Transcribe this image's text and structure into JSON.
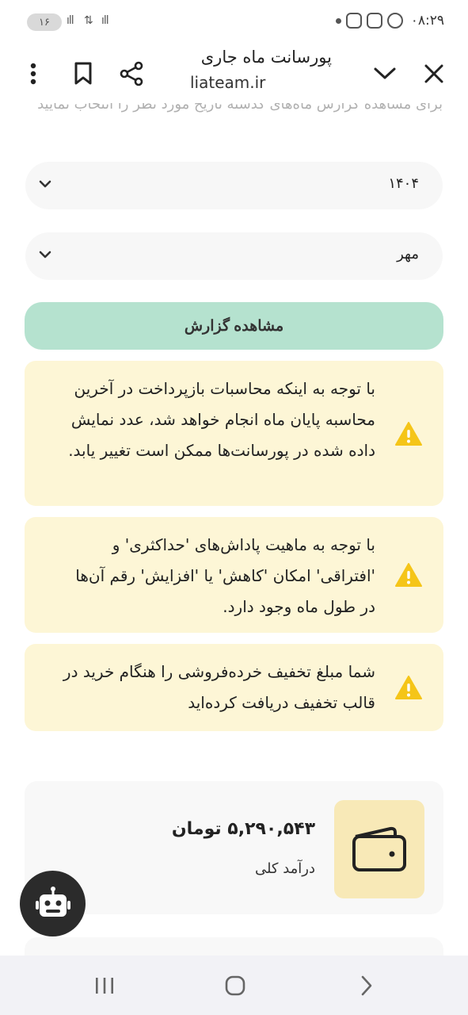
{
  "status_bar": {
    "battery": "۱۶",
    "clock": "۰۸:۲۹"
  },
  "header": {
    "title": "پورسانت ماه جاری",
    "url": "liateam.ir"
  },
  "intro": "برای مشاهده گزارش ماه‌های گذشته تاریخ مورد نظر را انتخاب نمایید",
  "filters": {
    "year": "۱۴۰۴",
    "month": "مهر"
  },
  "report_button_label": "مشاهده گزارش",
  "notices": [
    "با توجه به اینکه محاسبات بازپرداخت در آخرین محاسبه پایان ماه انجام خواهد شد، عدد نمایش داده شده در پورسانت‌ها ممکن است تغییر یابد.",
    "با توجه به ماهیت پاداش‌های 'حداکثری' و 'افتراقی' امکان 'کاهش' یا 'افزایش' رقم آن‌ها در طول ماه وجود دارد.",
    "شما مبلغ تخفیف خرده‌فروشی را هنگام خرید در قالب تخفیف دریافت کرده‌اید"
  ],
  "income": {
    "amount": "۵,۲۹۰,۵۴۳ تومان",
    "label": "درآمد کلی"
  },
  "colors": {
    "accent_button": "#b5e2cf",
    "notice_bg": "#fdf6d6",
    "warning_icon": "#f5c518",
    "wallet_bg": "#f8e9b7"
  }
}
